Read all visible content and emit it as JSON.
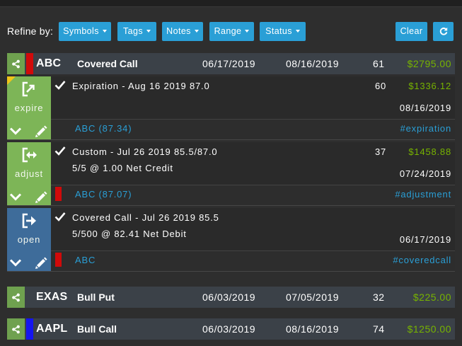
{
  "theme": {
    "accent": "#2a9fd6",
    "positive": "#77b300",
    "page_bg": "#2e2e2e",
    "position_bg": "#3b4148",
    "share_bg": "#6fa14f",
    "panel_bg": "#2a2a2a"
  },
  "filter_bar": {
    "label": "Refine by:",
    "dropdowns": [
      {
        "label": "Symbols",
        "icon": "caret-down-icon"
      },
      {
        "label": "Tags",
        "icon": "caret-down-icon"
      },
      {
        "label": "Notes",
        "icon": "caret-down-icon"
      },
      {
        "label": "Range",
        "icon": "caret-down-icon"
      },
      {
        "label": "Status",
        "icon": "caret-down-icon"
      }
    ],
    "clear_label": "Clear",
    "refresh_icon": "refresh-icon"
  },
  "positions": [
    {
      "share_icon": "share-icon",
      "color": "#d10a0a",
      "symbol": "ABC",
      "strategy": "Covered Call",
      "open_date": "06/17/2019",
      "close_date": "08/16/2019",
      "days": "61",
      "pnl": "$2795.00",
      "trades": [
        {
          "label": "expire",
          "icon": "expire-icon",
          "box_color": "#7db557",
          "flag_color": "#f0c419",
          "status_icon": "check-icon",
          "title": "Expiration - Aug 16 2019 87.0",
          "days": "60",
          "pnl": "$1336.12",
          "date": "08/16/2019",
          "underlying": "ABC (87.34)",
          "tag": "#expiration"
        },
        {
          "label": "adjust",
          "icon": "adjust-icon",
          "box_color": "#7db557",
          "marker_color": "#d10a0a",
          "status_icon": "check-icon",
          "title": "Custom - Jul 26 2019 85.5/87.0",
          "detail": "5/5 @ 1.00 Net Credit",
          "days": "37",
          "pnl": "$1458.88",
          "date": "07/24/2019",
          "underlying": "ABC (87.07)",
          "tag": "#adjustment"
        },
        {
          "label": "open",
          "icon": "open-icon",
          "box_color": "#3e6c9a",
          "marker_color": "#d10a0a",
          "status_icon": "check-icon",
          "title": "Covered Call - Jul 26 2019 85.5",
          "detail": "5/500 @ 82.41 Net Debit",
          "date": "06/17/2019",
          "underlying": "ABC",
          "tag": "#coveredcall"
        }
      ]
    },
    {
      "share_icon": "share-icon",
      "color": null,
      "symbol": "EXAS",
      "strategy": "Bull Put",
      "open_date": "06/03/2019",
      "close_date": "07/05/2019",
      "days": "32",
      "pnl": "$225.00"
    },
    {
      "share_icon": "share-icon",
      "color": "#1515f0",
      "symbol": "AAPL",
      "strategy": "Bull Call",
      "open_date": "06/03/2019",
      "close_date": "08/16/2019",
      "days": "74",
      "pnl": "$1250.00"
    }
  ]
}
